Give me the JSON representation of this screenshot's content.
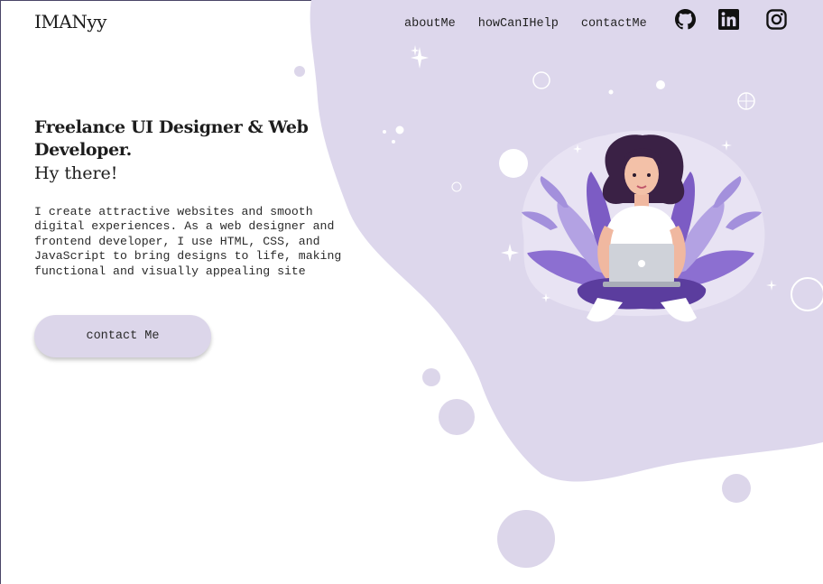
{
  "header": {
    "logo": "IMANyy",
    "nav": [
      "aboutMe",
      "howCanIHelp",
      "contactMe"
    ]
  },
  "socials": [
    {
      "icon": "github-icon"
    },
    {
      "icon": "linkedin-icon"
    },
    {
      "icon": "instagram-icon"
    }
  ],
  "hero": {
    "title": "Freelance UI Designer & Web Developer.",
    "subtitle": "Hy there!",
    "description": "I create attractive websites and smooth digital experiences. As a web designer and frontend developer, I use HTML, CSS, and JavaScript to bring designs to life, making functional and visually appealing site",
    "cta_label": "contact Me"
  },
  "colors": {
    "blob": "#ddd7ec",
    "accent": "#7c5cc4",
    "dark_purple": "#5b3d9e",
    "text": "#1d1d1d"
  }
}
